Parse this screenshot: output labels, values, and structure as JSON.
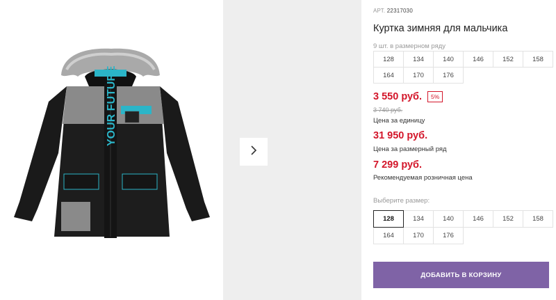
{
  "product": {
    "article_label": "АРТ.",
    "article_number": "22317030",
    "title": "Куртка зимняя для мальчика",
    "pack_label": "9 шт. в размерном ряду",
    "pack_sizes": [
      "128",
      "134",
      "140",
      "146",
      "152",
      "158",
      "164",
      "170",
      "176"
    ],
    "print_text": "YOUR FUTURE",
    "price": "3 550 руб.",
    "discount": "5%",
    "old_price": "3 740 руб.",
    "price_note": "Цена за единицу",
    "pack_price": "31 950 руб.",
    "pack_price_note": "Цена за размерный ряд",
    "retail_price": "7 299 руб.",
    "retail_price_note": "Рекомендуемая розничная цена",
    "choose_label": "Выберите размер:",
    "sizes": [
      "128",
      "134",
      "140",
      "146",
      "152",
      "158",
      "164",
      "170",
      "176"
    ],
    "selected_size": "128",
    "add_to_cart": "ДОБАВИТЬ В КОРЗИНУ"
  },
  "colors": {
    "price": "#d3162a",
    "button": "#7f63a6",
    "jacket": "#1d1d1d",
    "accent": "#2bb5c8",
    "grey": "#8a8a8a"
  },
  "icons": {
    "next": "chevron-right-icon"
  }
}
